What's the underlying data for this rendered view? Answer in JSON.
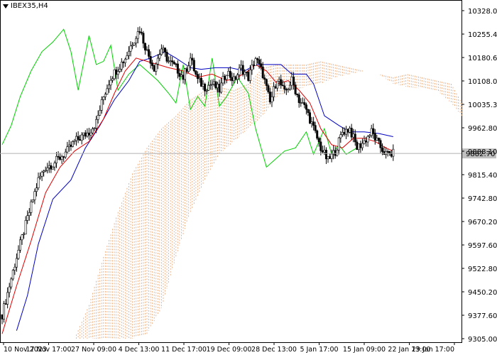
{
  "window": {
    "symbol_title": "IBEX35,H4",
    "menu_icon": "triangle-down-icon"
  },
  "chart_data": {
    "type": "candlestick",
    "title": "IBEX35,H4",
    "current_price": 9882.7,
    "y_tick_labels": [
      "10328.00",
      "10255.40",
      "10180.60",
      "10108.00",
      "10035.30",
      "9962.80",
      "9888.10",
      "9815.40",
      "9742.80",
      "9670.20",
      "9597.60",
      "9522.80",
      "9450.20",
      "9377.60",
      "9305.00"
    ],
    "ylim": [
      9305.0,
      10328.0
    ],
    "x_tick_labels": [
      "10 Nov 2023",
      "17 Nov 17:00",
      "27 Nov 09:00",
      "4 Dec 13:00",
      "11 Dec 17:00",
      "19 Dec 09:00",
      "28 Dec 13:00",
      "5 Jan 17:00",
      "15 Jan 09:00",
      "22 Jan 13:00",
      "29 Jan 17:00"
    ],
    "colors": {
      "tenkan": "#e00000",
      "kijun": "#0000c0",
      "chikou": "#00d000",
      "cloud": "#e8a070",
      "price_line": "#b0b0b0",
      "candle": "#000000"
    },
    "price_path": [
      [
        0,
        9380
      ],
      [
        4,
        9470
      ],
      [
        8,
        9560
      ],
      [
        12,
        9640
      ],
      [
        16,
        9720
      ],
      [
        20,
        9800
      ],
      [
        24,
        9840
      ],
      [
        28,
        9850
      ],
      [
        32,
        9870
      ],
      [
        36,
        9890
      ],
      [
        40,
        9920
      ],
      [
        44,
        9935
      ],
      [
        48,
        9950
      ],
      [
        52,
        9980
      ],
      [
        56,
        10060
      ],
      [
        60,
        10120
      ],
      [
        64,
        10150
      ],
      [
        68,
        10180
      ],
      [
        72,
        10230
      ],
      [
        76,
        10270
      ],
      [
        80,
        10200
      ],
      [
        84,
        10150
      ],
      [
        88,
        10210
      ],
      [
        92,
        10170
      ],
      [
        96,
        10150
      ],
      [
        100,
        10120
      ],
      [
        104,
        10180
      ],
      [
        108,
        10110
      ],
      [
        112,
        10090
      ],
      [
        116,
        10100
      ],
      [
        120,
        10080
      ],
      [
        124,
        10140
      ],
      [
        128,
        10110
      ],
      [
        132,
        10150
      ],
      [
        136,
        10120
      ],
      [
        140,
        10180
      ],
      [
        144,
        10130
      ],
      [
        148,
        10040
      ],
      [
        152,
        10120
      ],
      [
        156,
        10070
      ],
      [
        160,
        10110
      ],
      [
        164,
        10050
      ],
      [
        168,
        10020
      ],
      [
        172,
        9960
      ],
      [
        176,
        9900
      ],
      [
        180,
        9860
      ],
      [
        184,
        9890
      ],
      [
        188,
        9950
      ],
      [
        192,
        9960
      ],
      [
        196,
        9900
      ],
      [
        200,
        9920
      ],
      [
        204,
        9950
      ],
      [
        208,
        9910
      ],
      [
        212,
        9880
      ],
      [
        216,
        9882
      ]
    ],
    "tenkan": [
      [
        0,
        9320
      ],
      [
        8,
        9470
      ],
      [
        16,
        9610
      ],
      [
        24,
        9760
      ],
      [
        32,
        9840
      ],
      [
        40,
        9890
      ],
      [
        48,
        9920
      ],
      [
        56,
        9990
      ],
      [
        62,
        10070
      ],
      [
        68,
        10140
      ],
      [
        74,
        10180
      ],
      [
        80,
        10170
      ],
      [
        86,
        10160
      ],
      [
        92,
        10150
      ],
      [
        100,
        10140
      ],
      [
        108,
        10120
      ],
      [
        116,
        10130
      ],
      [
        124,
        10110
      ],
      [
        130,
        10120
      ],
      [
        136,
        10140
      ],
      [
        140,
        10160
      ],
      [
        146,
        10140
      ],
      [
        152,
        10100
      ],
      [
        158,
        10110
      ],
      [
        164,
        10080
      ],
      [
        170,
        10040
      ],
      [
        176,
        9960
      ],
      [
        182,
        9910
      ],
      [
        188,
        9900
      ],
      [
        194,
        9930
      ],
      [
        200,
        9930
      ],
      [
        206,
        9920
      ],
      [
        212,
        9900
      ],
      [
        216,
        9890
      ]
    ],
    "kijun": [
      [
        8,
        9330
      ],
      [
        14,
        9440
      ],
      [
        20,
        9600
      ],
      [
        28,
        9740
      ],
      [
        38,
        9800
      ],
      [
        46,
        9900
      ],
      [
        54,
        9970
      ],
      [
        62,
        10050
      ],
      [
        70,
        10110
      ],
      [
        76,
        10170
      ],
      [
        82,
        10180
      ],
      [
        90,
        10200
      ],
      [
        96,
        10180
      ],
      [
        104,
        10150
      ],
      [
        110,
        10145
      ],
      [
        118,
        10150
      ],
      [
        126,
        10150
      ],
      [
        134,
        10140
      ],
      [
        140,
        10160
      ],
      [
        146,
        10160
      ],
      [
        154,
        10160
      ],
      [
        160,
        10130
      ],
      [
        168,
        10130
      ],
      [
        172,
        10100
      ],
      [
        178,
        10000
      ],
      [
        186,
        9970
      ],
      [
        192,
        9950
      ],
      [
        200,
        9950
      ],
      [
        208,
        9945
      ],
      [
        216,
        9935
      ]
    ],
    "chikou": [
      [
        0,
        9910
      ],
      [
        5,
        9970
      ],
      [
        10,
        10060
      ],
      [
        16,
        10140
      ],
      [
        22,
        10200
      ],
      [
        28,
        10230
      ],
      [
        34,
        10270
      ],
      [
        38,
        10200
      ],
      [
        42,
        10080
      ],
      [
        48,
        10250
      ],
      [
        52,
        10160
      ],
      [
        56,
        10170
      ],
      [
        60,
        10220
      ],
      [
        64,
        10080
      ],
      [
        70,
        10130
      ],
      [
        76,
        10160
      ],
      [
        80,
        10140
      ],
      [
        86,
        10110
      ],
      [
        92,
        10070
      ],
      [
        96,
        10040
      ],
      [
        100,
        10160
      ],
      [
        104,
        10020
      ],
      [
        108,
        10060
      ],
      [
        112,
        10030
      ],
      [
        116,
        10180
      ],
      [
        120,
        10030
      ],
      [
        124,
        10060
      ],
      [
        130,
        10120
      ],
      [
        136,
        10070
      ],
      [
        140,
        9960
      ],
      [
        146,
        9840
      ],
      [
        150,
        9860
      ],
      [
        156,
        9890
      ],
      [
        162,
        9900
      ],
      [
        168,
        9950
      ],
      [
        172,
        9880
      ],
      [
        178,
        9960
      ],
      [
        182,
        9880
      ],
      [
        186,
        9910
      ],
      [
        190,
        9880
      ],
      [
        196,
        9900
      ]
    ],
    "cloud_upper": [
      [
        40,
        9305
      ],
      [
        48,
        9410
      ],
      [
        56,
        9560
      ],
      [
        64,
        9700
      ],
      [
        72,
        9820
      ],
      [
        80,
        9900
      ],
      [
        88,
        9960
      ],
      [
        96,
        10000
      ],
      [
        104,
        10050
      ],
      [
        112,
        10080
      ],
      [
        120,
        10090
      ],
      [
        128,
        10080
      ],
      [
        136,
        10100
      ],
      [
        144,
        10150
      ],
      [
        152,
        10160
      ],
      [
        160,
        10160
      ],
      [
        168,
        10160
      ],
      [
        176,
        10170
      ],
      [
        184,
        10160
      ],
      [
        192,
        10150
      ],
      [
        200,
        10140
      ],
      [
        208,
        10130
      ],
      [
        216,
        10120
      ],
      [
        224,
        10130
      ],
      [
        232,
        10120
      ],
      [
        240,
        10110
      ],
      [
        248,
        10100
      ],
      [
        254,
        10040
      ]
    ],
    "cloud_lower": [
      [
        40,
        9305
      ],
      [
        48,
        9305
      ],
      [
        56,
        9305
      ],
      [
        64,
        9305
      ],
      [
        72,
        9305
      ],
      [
        80,
        9320
      ],
      [
        88,
        9400
      ],
      [
        96,
        9560
      ],
      [
        104,
        9700
      ],
      [
        112,
        9800
      ],
      [
        120,
        9880
      ],
      [
        128,
        9920
      ],
      [
        136,
        9960
      ],
      [
        144,
        10000
      ],
      [
        152,
        10060
      ],
      [
        160,
        10080
      ],
      [
        168,
        10090
      ],
      [
        176,
        10100
      ],
      [
        184,
        10120
      ],
      [
        192,
        10130
      ],
      [
        200,
        10140
      ],
      [
        208,
        10130
      ],
      [
        216,
        10100
      ],
      [
        224,
        10090
      ],
      [
        232,
        10085
      ],
      [
        240,
        10080
      ],
      [
        248,
        10040
      ],
      [
        254,
        10000
      ]
    ]
  }
}
